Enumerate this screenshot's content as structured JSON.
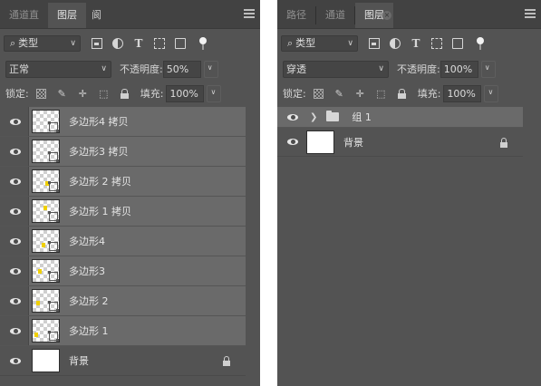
{
  "left_panel": {
    "tabs": [
      {
        "label": "通道直",
        "active": false
      },
      {
        "label": "图层",
        "active": true
      },
      {
        "label": "阆",
        "active": false
      }
    ],
    "filter_kind": "类型",
    "blend_mode": "正常",
    "opacity_label": "不透明度:",
    "opacity_value": "50%",
    "lock_label": "锁定:",
    "fill_label": "填充:",
    "fill_value": "100%",
    "layers": [
      {
        "name": "多边形4 拷贝",
        "type": "shape",
        "selected": true
      },
      {
        "name": "多边形3 拷贝",
        "type": "shape",
        "selected": true
      },
      {
        "name": "多边形 2 拷贝",
        "type": "shape",
        "selected": true
      },
      {
        "name": "多边形 1 拷贝",
        "type": "shape",
        "selected": true
      },
      {
        "name": "多边形4",
        "type": "shape",
        "selected": true
      },
      {
        "name": "多边形3",
        "type": "shape",
        "selected": true
      },
      {
        "name": "多边形 2",
        "type": "shape",
        "selected": true
      },
      {
        "name": "多边形 1",
        "type": "shape",
        "selected": true
      },
      {
        "name": "背景",
        "type": "background",
        "locked": true
      }
    ]
  },
  "right_panel": {
    "tabs": [
      {
        "label": "路径",
        "active": false
      },
      {
        "label": "通道",
        "active": false
      },
      {
        "label": "图层",
        "active": true
      }
    ],
    "filter_kind": "类型",
    "blend_mode": "穿透",
    "opacity_label": "不透明度:",
    "opacity_value": "100%",
    "lock_label": "锁定:",
    "fill_label": "填充:",
    "fill_value": "100%",
    "group": {
      "name": "组 1",
      "expanded": false
    },
    "background_layer": {
      "name": "背景",
      "locked": true
    }
  },
  "colors": {
    "panel_bg": "#535353",
    "tab_bar_bg": "#424242",
    "selected_row_bg": "#6a6a6a",
    "accent_yellow": "#f0d000"
  }
}
